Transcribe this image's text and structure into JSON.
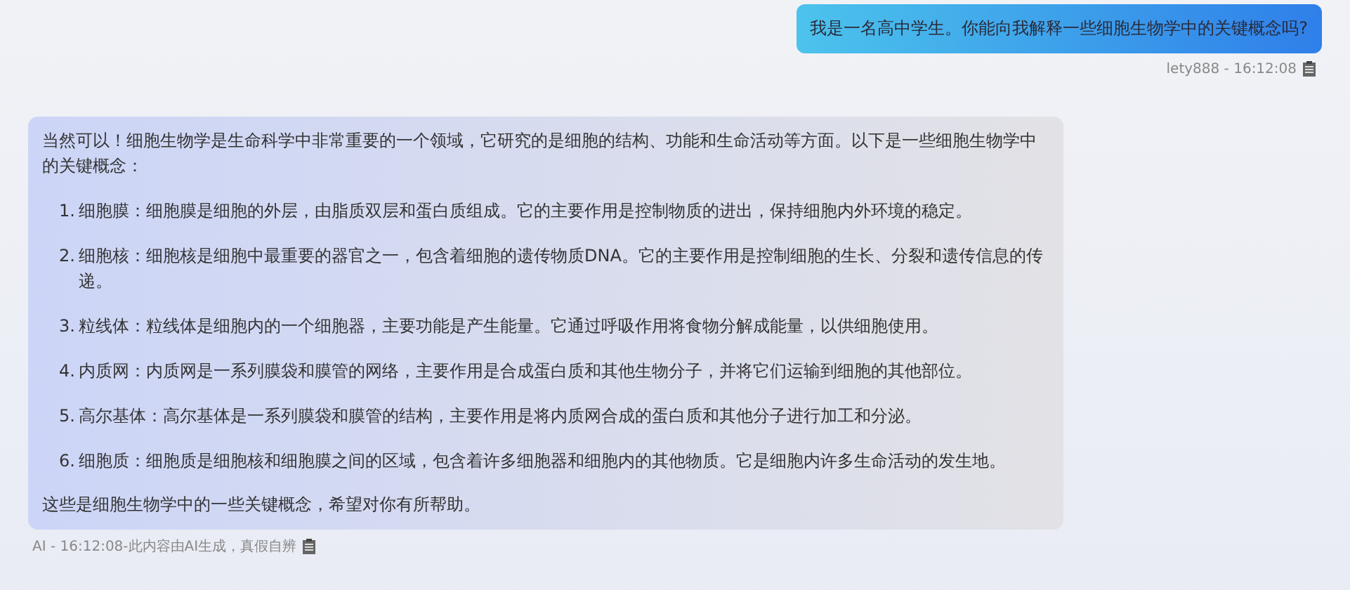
{
  "messages": [
    {
      "kind": "user",
      "text": "我是一名高中学生。你能向我解释一些细胞生物学中的关键概念吗?",
      "meta": "lety888 - 16:12:08"
    },
    {
      "kind": "ai",
      "intro": "当然可以！细胞生物学是生命科学中非常重要的一个领域，它研究的是细胞的结构、功能和生命活动等方面。以下是一些细胞生物学中的关键概念：",
      "items": [
        {
          "number": "1.",
          "text": "细胞膜：细胞膜是细胞的外层，由脂质双层和蛋白质组成。它的主要作用是控制物质的进出，保持细胞内外环境的稳定。"
        },
        {
          "number": "2.",
          "text": "细胞核：细胞核是细胞中最重要的器官之一，包含着细胞的遗传物质DNA。它的主要作用是控制细胞的生长、分裂和遗传信息的传递。"
        },
        {
          "number": "3.",
          "text": "粒线体：粒线体是细胞内的一个细胞器，主要功能是产生能量。它通过呼吸作用将食物分解成能量，以供细胞使用。"
        },
        {
          "number": "4.",
          "text": "内质网：内质网是一系列膜袋和膜管的网络，主要作用是合成蛋白质和其他生物分子，并将它们运输到细胞的其他部位。"
        },
        {
          "number": "5.",
          "text": "高尔基体：高尔基体是一系列膜袋和膜管的结构，主要作用是将内质网合成的蛋白质和其他分子进行加工和分泌。"
        },
        {
          "number": "6.",
          "text": "细胞质：细胞质是细胞核和细胞膜之间的区域，包含着许多细胞器和细胞内的其他物质。它是细胞内许多生命活动的发生地。"
        }
      ],
      "outro": "这些是细胞生物学中的一些关键概念，希望对你有所帮助。",
      "meta": "AI - 16:12:08-此内容由AI生成，真假自辨"
    }
  ]
}
